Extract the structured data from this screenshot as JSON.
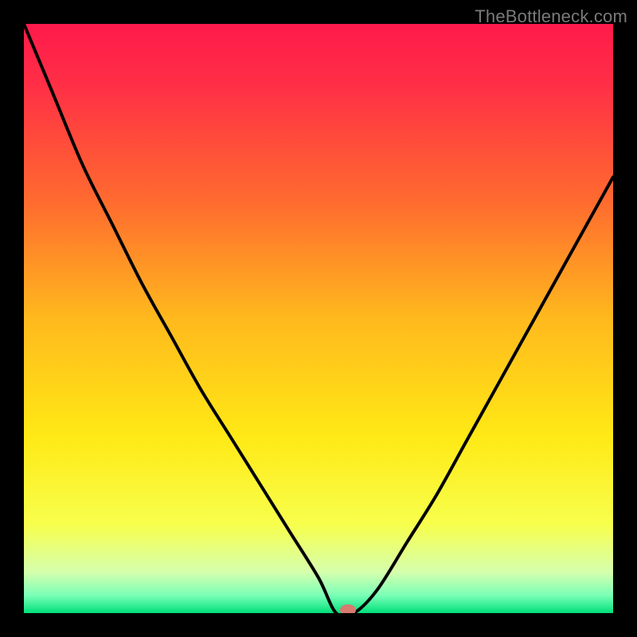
{
  "watermark": "TheBottleneck.com",
  "chart_data": {
    "type": "line",
    "title": "",
    "xlabel": "",
    "ylabel": "",
    "xlim": [
      0,
      100
    ],
    "ylim": [
      0,
      100
    ],
    "series": [
      {
        "name": "curve",
        "x": [
          0,
          5,
          10,
          15,
          20,
          25,
          30,
          35,
          40,
          45,
          50,
          53,
          56,
          60,
          65,
          70,
          75,
          80,
          85,
          90,
          95,
          100
        ],
        "values": [
          100,
          88,
          76,
          66,
          56,
          47,
          38,
          30,
          22,
          14,
          6,
          0,
          0,
          4,
          12,
          20,
          29,
          38,
          47,
          56,
          65,
          74
        ]
      }
    ],
    "marker": {
      "x": 55,
      "y": 0
    },
    "gradient_stops": [
      {
        "offset": 0.0,
        "color": "#ff1a4b"
      },
      {
        "offset": 0.1,
        "color": "#ff2e46"
      },
      {
        "offset": 0.3,
        "color": "#ff6a2f"
      },
      {
        "offset": 0.5,
        "color": "#ffb91d"
      },
      {
        "offset": 0.7,
        "color": "#ffe915"
      },
      {
        "offset": 0.85,
        "color": "#f7ff4d"
      },
      {
        "offset": 0.93,
        "color": "#d6ffad"
      },
      {
        "offset": 0.97,
        "color": "#7affb7"
      },
      {
        "offset": 1.0,
        "color": "#00e07a"
      }
    ]
  }
}
